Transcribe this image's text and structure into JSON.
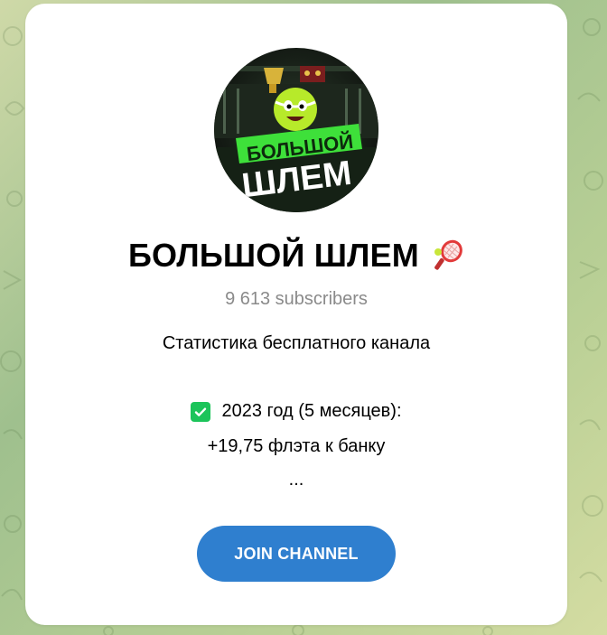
{
  "channel": {
    "title": "БОЛЬШОЙ ШЛЕМ",
    "title_emoji_icon": "tennis-racket-icon",
    "subscribers": "9 613 subscribers",
    "avatar_text_line1": "БОЛЬШОЙ",
    "avatar_text_line2": "ШЛЕМ"
  },
  "description": {
    "line1": "Статистика бесплатного канала",
    "line2": "2023 год (5 месяцев):",
    "line2_icon": "check-mark-button-icon",
    "line3": "+19,75 флэта к банку",
    "line4": "..."
  },
  "actions": {
    "join_label": "JOIN CHANNEL"
  },
  "colors": {
    "accent": "#2f7fcf",
    "check": "#1cc45a",
    "subtle_text": "#8a8a8a",
    "avatar_green": "#3ee03a"
  }
}
